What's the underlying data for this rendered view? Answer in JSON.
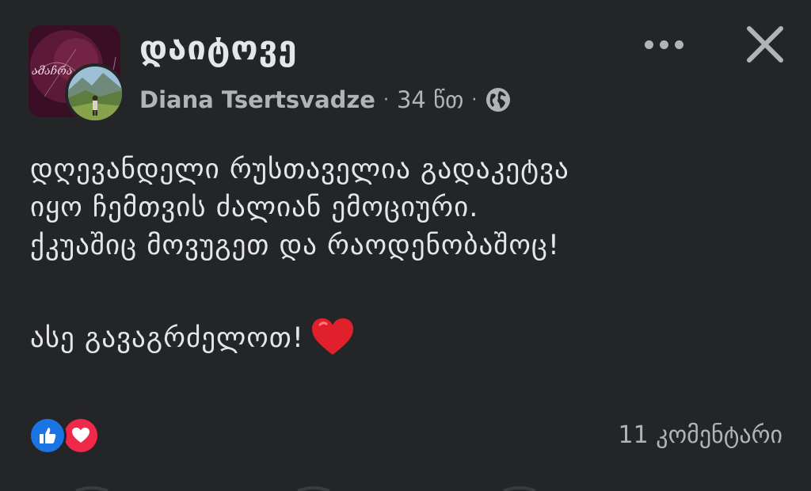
{
  "post": {
    "group_name": "დაიტოვე",
    "author": "Diana Tsertsvadze",
    "separator": "·",
    "time": "34 წთ",
    "privacy_icon": "globe-icon",
    "text_lines": [
      "დღევანდელი რუსთაველია გადაკეტვა",
      "იყო ჩემთვის ძალიან ემოციური.",
      "ქკუაშიც მოვუგეთ და რაოდენობაშოც!"
    ],
    "closing_line": "ასე გავაგრძელოთ!",
    "closing_emoji": "heart-emoji",
    "group_avatar_text": "ამაჩრა",
    "reactions": [
      "like-reaction",
      "love-reaction"
    ],
    "comments": "11 კომენტარი"
  },
  "colors": {
    "background": "#242526",
    "primary_text": "#e4e6eb",
    "secondary_text": "#b0b3b8",
    "like": "#1b74e4",
    "love": "#f0284a"
  }
}
